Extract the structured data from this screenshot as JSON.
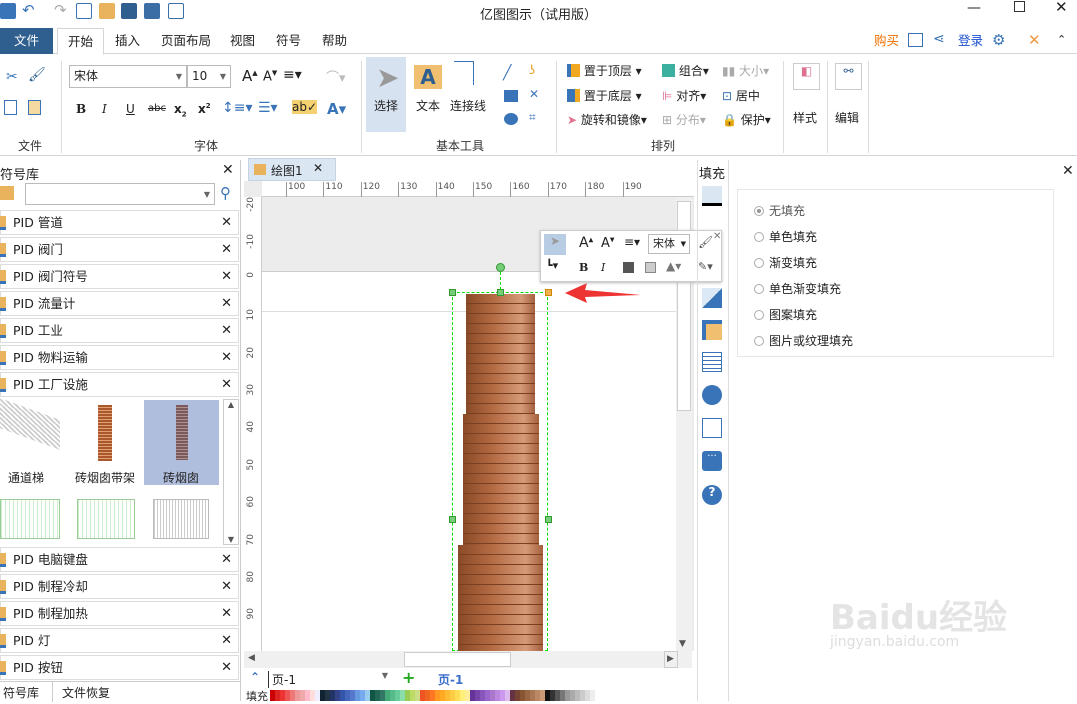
{
  "window": {
    "title": "亿图图示（试用版）"
  },
  "menu": {
    "file": "文件",
    "tabs": [
      "开始",
      "插入",
      "页面布局",
      "视图",
      "符号",
      "帮助"
    ],
    "buy": "购买",
    "login": "登录"
  },
  "ribbon": {
    "groups": [
      "文件",
      "字体",
      "基本工具",
      "排列"
    ],
    "font_name": "宋体",
    "font_size": "10",
    "tools": {
      "select": "选择",
      "text": "文本",
      "connector": "连接线"
    },
    "arrange": {
      "front": "置于顶层",
      "back": "置于底层",
      "rotate": "旋转和镜像",
      "group": "组合",
      "align": "对齐",
      "distribute": "分布",
      "size": "大小",
      "center": "居中",
      "protect": "保护"
    },
    "style": "样式",
    "edit": "编辑"
  },
  "library": {
    "title": "符号库",
    "search_placeholder": "",
    "items_top": [
      "PID 管道",
      "PID 阀门",
      "PID 阀门符号",
      "PID 流量计",
      "PID 工业",
      "PID 物料运输",
      "PID 工厂设施"
    ],
    "gallery": [
      "通道梯",
      "砖烟囱带架",
      "砖烟囱"
    ],
    "items_bottom": [
      "PID 电脑键盘",
      "PID 制程冷却",
      "PID 制程加热",
      "PID 灯",
      "PID 按钮"
    ],
    "bottom_tabs": [
      "符号库",
      "文件恢复"
    ]
  },
  "document": {
    "tab": "绘图1",
    "ruler_top": [
      "100",
      "110",
      "120",
      "130",
      "140",
      "150",
      "160",
      "170",
      "180",
      "190"
    ],
    "ruler_left": [
      "-20",
      "-10",
      "0",
      "10",
      "20",
      "30",
      "40",
      "50",
      "60",
      "70",
      "80",
      "90"
    ],
    "page_select": "页-1",
    "page_tab": "页-1",
    "palette_label": "填充"
  },
  "minitoolbar": {
    "font": "宋体"
  },
  "fill_panel": {
    "title": "填充",
    "options": [
      "无填充",
      "单色填充",
      "渐变填充",
      "单色渐变填充",
      "图案填充",
      "图片或纹理填充"
    ],
    "selected": "无填充"
  },
  "colors": {
    "accent": "#2f5f8f",
    "buy": "#f07000",
    "login": "#1a4fd0",
    "selection": "#00dd00",
    "arrow": "#ee3333"
  }
}
